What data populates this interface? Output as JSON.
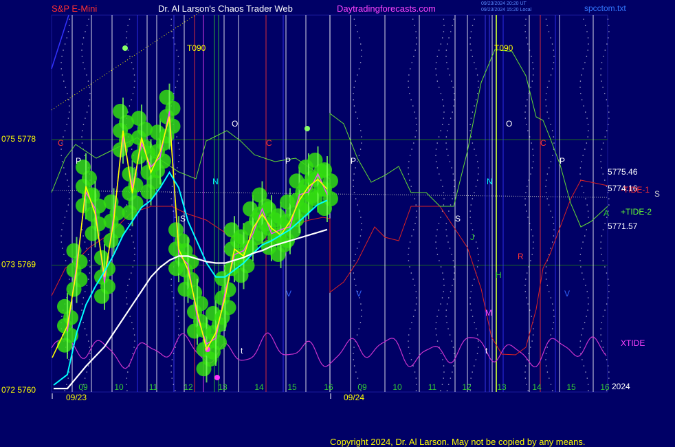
{
  "header": {
    "instrument": "S&P E-Mini",
    "title": "Dr. Al Larson's Chaos Trader Web",
    "site": "Daytradingforecasts.com",
    "stamp_utc": "09/23/2024 20:20 UT",
    "stamp_local": "09/23/2024 15:20 Local",
    "file": "spcctom.txt"
  },
  "footer": {
    "copyright": "Copyright 2024, Dr. Al Larson. May not be copied by any means.",
    "year": "2024"
  },
  "colors": {
    "background": "#000066",
    "price": "#ffff00",
    "ma_fast": "#00ffff",
    "ma_slow": "#ffffff",
    "tide_plus": "#66dd33",
    "tide_minus": "#dd2222",
    "xtide": "#cc33cc",
    "dots": "#33dd11"
  },
  "chart_data": {
    "type": "line",
    "title": "S&P E-Mini",
    "y_ticks": [
      {
        "label": "075  5778",
        "value": 5778
      },
      {
        "label": "073  5769",
        "value": 5769
      },
      {
        "label": "072  5760",
        "value": 5760
      }
    ],
    "ylim": [
      5760,
      5778
    ],
    "x_ticks_day1": [
      "09",
      "10",
      "11",
      "12",
      "13",
      "14",
      "15",
      "16"
    ],
    "x_ticks_day2": [
      "09",
      "10",
      "11",
      "12",
      "13",
      "14",
      "15",
      "16"
    ],
    "dates": [
      "09/23",
      "09/24"
    ],
    "level_labels": [
      {
        "label": "5775.46",
        "value": 5775.46
      },
      {
        "label": "5774.16",
        "value": 5774.16
      },
      {
        "label": "5771.57",
        "value": 5771.57
      }
    ],
    "series_labels": [
      "-TIDE-1",
      "+TIDE-2",
      "XTIDE",
      "S"
    ],
    "markers": [
      "C",
      "P",
      "S",
      "T090",
      "N",
      "O",
      "C",
      "P",
      "P",
      "V",
      "V",
      "t",
      "S",
      "J",
      "N",
      "T090",
      "O",
      "H",
      "M",
      "t",
      "R",
      "C",
      "P",
      "V",
      "A"
    ],
    "price_series": {
      "name": "S&P E-Mini",
      "x": [
        "09:00",
        "09:15",
        "09:30",
        "09:45",
        "10:00",
        "10:15",
        "10:30",
        "10:45",
        "11:00",
        "11:15",
        "11:30",
        "11:45",
        "12:00",
        "12:15",
        "12:30",
        "12:45",
        "13:00",
        "13:15",
        "13:30",
        "13:45",
        "14:00",
        "14:15",
        "14:30",
        "14:45",
        "15:00",
        "15:15",
        "15:30",
        "15:45",
        "16:00"
      ],
      "values": [
        5764.5,
        5768.5,
        5774.5,
        5772.5,
        5768.0,
        5772.0,
        5778.5,
        5774.0,
        5778.0,
        5775.5,
        5777.0,
        5779.5,
        5770.0,
        5768.5,
        5765.5,
        5762.8,
        5764.0,
        5766.5,
        5770.0,
        5769.5,
        5771.5,
        5772.5,
        5771.5,
        5771.0,
        5772.0,
        5773.5,
        5774.5,
        5775.0,
        5774.3
      ]
    },
    "ma_fast": [
      5761.0,
      5764.0,
      5766.0,
      5767.3,
      5768.4,
      5769.6,
      5771.0,
      5772.0,
      5773.0,
      5773.5,
      5774.4,
      5775.5,
      5774.4,
      5772.0,
      5770.5,
      5769.0,
      5768.0,
      5768.0,
      5768.5,
      5769.0,
      5769.7,
      5770.3,
      5770.6,
      5771.0,
      5771.4,
      5772.0,
      5772.6,
      5773.2,
      5773.5
    ],
    "ma_slow": [
      5760.0,
      5760.8,
      5761.6,
      5762.3,
      5763.0,
      5764.0,
      5765.0,
      5766.0,
      5767.0,
      5768.0,
      5768.7,
      5769.2,
      5769.5,
      5769.5,
      5769.3,
      5769.1,
      5769.0,
      5769.0,
      5769.2,
      5769.4,
      5769.7,
      5769.9,
      5770.2,
      5770.4,
      5770.6,
      5770.8,
      5771.0,
      5771.2,
      5771.4
    ]
  }
}
